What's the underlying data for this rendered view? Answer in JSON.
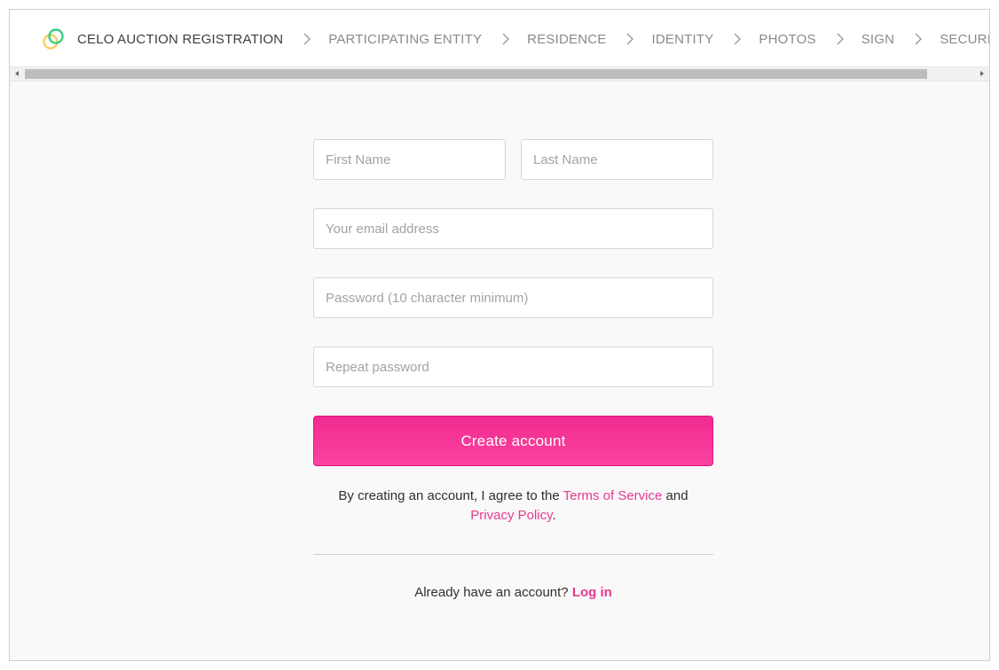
{
  "colors": {
    "accent": "#f0358f",
    "link": "#e8398f",
    "logo_ring_green": "#35d07f",
    "logo_ring_gold": "#fbcc5c"
  },
  "stepbar": {
    "app_title": "CELO AUCTION REGISTRATION",
    "logo_icon": "celo-logo",
    "separator_icon": "chevron-right-icon",
    "steps": [
      "PARTICIPATING ENTITY",
      "RESIDENCE",
      "IDENTITY",
      "PHOTOS",
      "SIGN",
      "SECURITY"
    ]
  },
  "form": {
    "first_name_placeholder": "First Name",
    "last_name_placeholder": "Last Name",
    "email_placeholder": "Your email address",
    "password_placeholder": "Password (10 character minimum)",
    "repeat_password_placeholder": "Repeat password",
    "submit_label": "Create account",
    "terms_prefix": "By creating an account, I agree to the ",
    "terms_link": "Terms of Service",
    "terms_and": " and",
    "privacy_link": "Privacy Policy",
    "terms_suffix": ".",
    "login_prompt": "Already have an account? ",
    "login_link": "Log in"
  }
}
